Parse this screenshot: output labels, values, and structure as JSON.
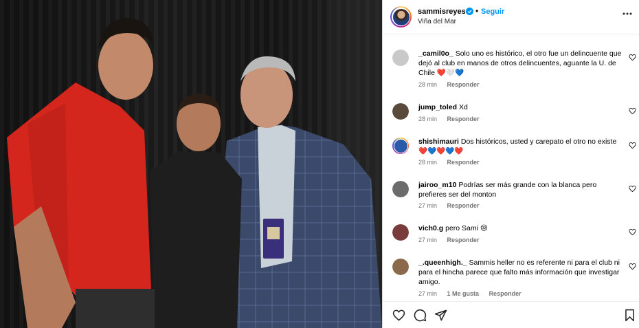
{
  "post": {
    "username": "sammisreyes",
    "follow_label": "Seguir",
    "separator": "•",
    "location": "Viña del Mar",
    "photo_icon": "photo-of-three-men",
    "colors": {
      "link": "#0095f6",
      "muted": "#737373",
      "heart_red": "#e0245e"
    }
  },
  "comments": [
    {
      "user": "_camil0o_",
      "text": "Solo uno es histórico, el otro fue un delincuente que dejó al club en manos de otros delincuentes, aguante la U. de Chile ❤️🤍💙",
      "time": "28 min",
      "reply": "Responder",
      "avatar_color": "#c9c9c9"
    },
    {
      "user": "jump_toled",
      "text": "Xd",
      "time": "28 min",
      "reply": "Responder",
      "avatar_color": "#5a4a3a"
    },
    {
      "user": "shishimauri",
      "text": "Dos históricos, usted y carepato el otro no existe ❤️💙❤️💙❤️",
      "time": "28 min",
      "reply": "Responder",
      "avatar_color": "#2a5aa8"
    },
    {
      "user": "jairoo_m10",
      "text": "Podrías ser más grande con la blanca pero prefieres ser del monton",
      "time": "27 min",
      "reply": "Responder",
      "avatar_color": "#6b6b6b"
    },
    {
      "user": "vich0.g",
      "text": "pero Sami 😒",
      "time": "27 min",
      "reply": "Responder",
      "avatar_color": "#7a3b3b"
    },
    {
      "user": "_.queenhigh._",
      "text": "Sammis heller no es referente ni para el club ni para el hincha parece que falto más información que investigar amigo.",
      "time": "27 min",
      "likes": "1 Me gusta",
      "reply": "Responder",
      "avatar_color": "#8a6a4a"
    }
  ],
  "actions": {
    "like_icon": "heart-icon",
    "comment_icon": "comment-icon",
    "share_icon": "share-icon",
    "save_icon": "bookmark-icon"
  }
}
